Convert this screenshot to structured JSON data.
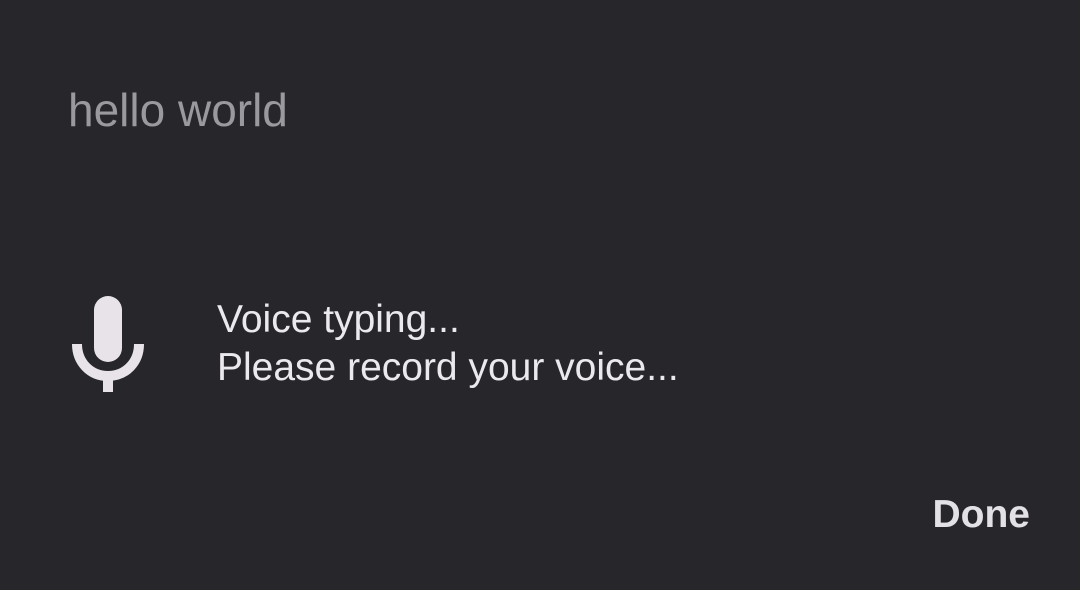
{
  "input": {
    "text": "hello world"
  },
  "voice": {
    "title": "Voice typing...",
    "prompt": "Please record your voice...",
    "icon": "microphone-icon"
  },
  "actions": {
    "done_label": "Done"
  },
  "colors": {
    "background": "#26262b",
    "text_primary": "#ece9ee",
    "text_secondary": "#9a9a9e",
    "icon": "#e8e3e8"
  }
}
